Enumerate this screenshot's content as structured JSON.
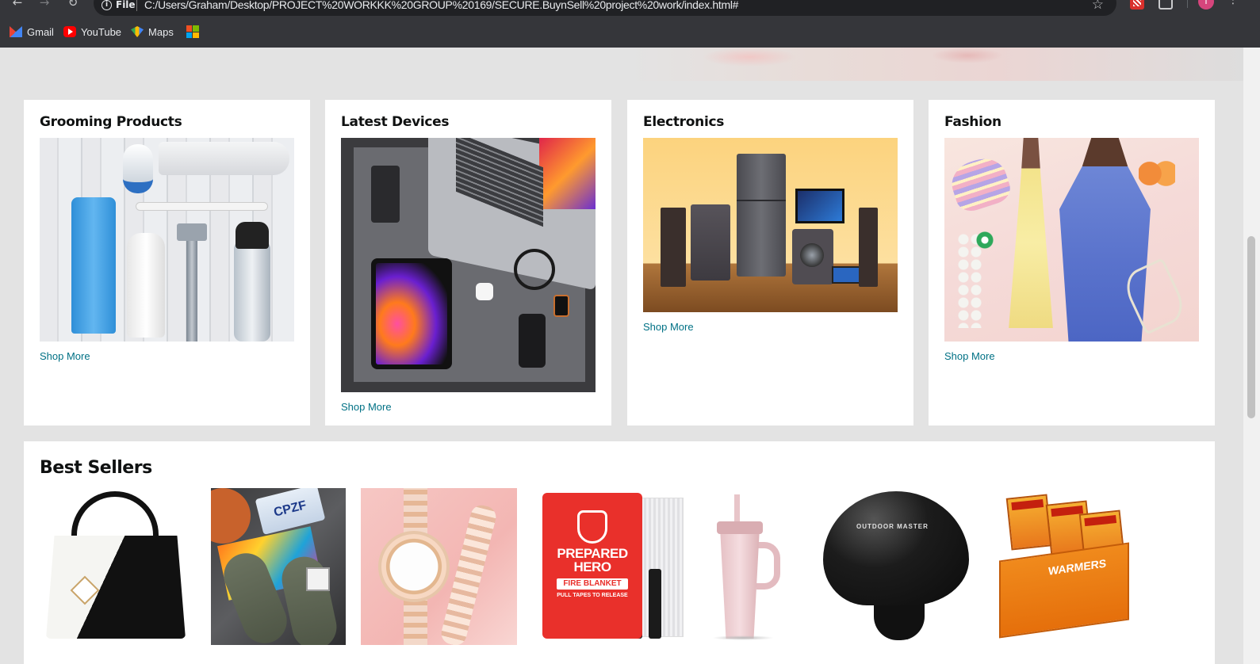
{
  "browser": {
    "url_scheme_label": "File",
    "url": "C:/Users/Graham/Desktop/PROJECT%20WORKKK%20GROUP%20169/SECURE.BuynSell%20project%20work/index.html#",
    "profile_initial": "T",
    "bookmarks": [
      {
        "label": "Gmail",
        "icon": "gmail-icon"
      },
      {
        "label": "YouTube",
        "icon": "youtube-icon"
      },
      {
        "label": "Maps",
        "icon": "maps-icon"
      }
    ],
    "microsoft_colors": [
      "#f25022",
      "#7fba00",
      "#00a4ef",
      "#ffb900"
    ]
  },
  "categories": [
    {
      "title": "Grooming Products",
      "link": "Shop More",
      "image": "grooming-products-photo"
    },
    {
      "title": "Latest Devices",
      "link": "Shop More",
      "image": "devices-flatlay-photo"
    },
    {
      "title": "Electronics",
      "link": "Shop More",
      "image": "home-electronics-photo"
    },
    {
      "title": "Fashion",
      "link": "Shop More",
      "image": "fashion-models-photo"
    }
  ],
  "best_sellers": {
    "title": "Best Sellers",
    "products": [
      {
        "image": "handbag-photo"
      },
      {
        "image": "slides-photo",
        "plate_text": "CPZF"
      },
      {
        "image": "rose-gold-watch-photo"
      },
      {
        "image": "fire-blanket-photo",
        "brand": "PREPARED HERO",
        "label": "FIRE BLANKET",
        "note": "PULL TAPES TO RELEASE"
      },
      {
        "image": "tumbler-photo"
      },
      {
        "image": "ski-helmet-photo",
        "brand": "OUTDOOR MASTER"
      },
      {
        "image": "hand-warmers-photo",
        "label": "WARMERS"
      }
    ]
  },
  "colors": {
    "page_background": "#e3e3e3",
    "card_background": "#ffffff",
    "link": "#007185",
    "heading": "#0f1111",
    "chrome": "#35363a"
  }
}
